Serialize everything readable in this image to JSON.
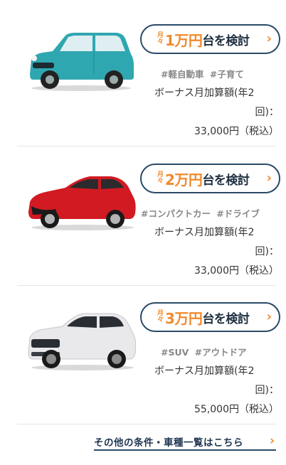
{
  "cards": [
    {
      "tsuki": [
        "月",
        "々"
      ],
      "amount": "1万円",
      "kento": "台を検討",
      "tags": [
        "#軽自動車",
        "#子育て"
      ],
      "price_line1": "ボーナス月加算額(年2",
      "price_line2": "回)：",
      "price_line3": "33,000円（税込）",
      "car_color": "#2fa7b0",
      "car_name": "teal-kei-car"
    },
    {
      "tsuki": [
        "月",
        "々"
      ],
      "amount": "2万円",
      "kento": "台を検討",
      "tags": [
        "#コンパクトカー",
        "#ドライブ"
      ],
      "price_line1": "ボーナス月加算額(年2",
      "price_line2": "回)：",
      "price_line3": "33,000円（税込）",
      "car_color": "#d11a22",
      "car_name": "red-compact-car"
    },
    {
      "tsuki": [
        "月",
        "々"
      ],
      "amount": "3万円",
      "kento": "台を検討",
      "tags": [
        "#SUV",
        "#アウトドア"
      ],
      "price_line1": "ボーナス月加算額(年2",
      "price_line2": "回)：",
      "price_line3": "55,000円（税込）",
      "car_color": "#e8e8ea",
      "car_name": "white-suv"
    }
  ],
  "more_link": "その他の条件・車種一覧はこちら",
  "colors": {
    "accent": "#f08a2c",
    "navy": "#2a4a68",
    "tag": "#888888"
  }
}
